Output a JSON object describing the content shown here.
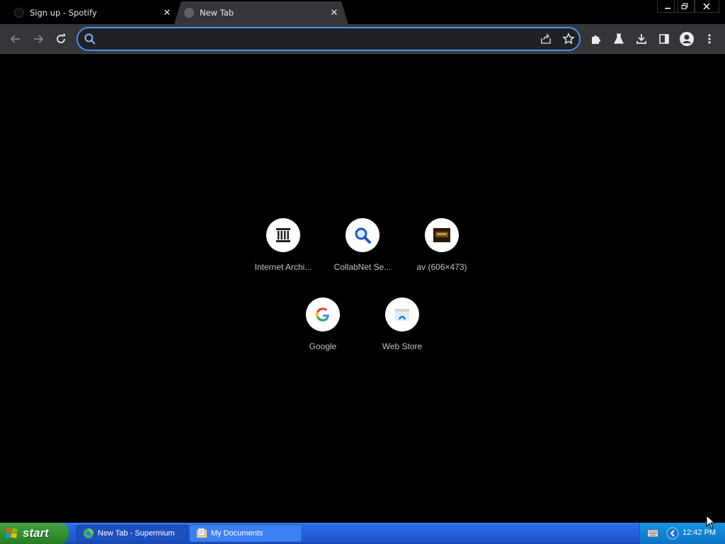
{
  "tabs": [
    {
      "title": "Sign up - Spotify",
      "active": false
    },
    {
      "title": "New Tab",
      "active": true
    }
  ],
  "window_controls": {
    "minimize": "–",
    "restore": "❐",
    "close": "✕"
  },
  "toolbar": {
    "back": "←",
    "forward": "→",
    "reload": "↻",
    "omnibox_value": "",
    "omnibox_placeholder": "",
    "menu": "⋮"
  },
  "shortcuts": [
    {
      "label": "Internet Archi...",
      "icon": "internet-archive-icon"
    },
    {
      "label": "CollabNet Se...",
      "icon": "magnifier-icon"
    },
    {
      "label": "av (606×473)",
      "icon": "av-thumbnail-icon"
    },
    {
      "label": "Google",
      "icon": "google-g-icon"
    },
    {
      "label": "Web Store",
      "icon": "web-store-icon"
    }
  ],
  "taskbar": {
    "start_label": "start",
    "tasks": [
      {
        "label": "New Tab - Supermium",
        "active": true
      },
      {
        "label": "My Documents",
        "active": false
      }
    ],
    "clock": "12:42 PM"
  },
  "colors": {
    "accent": "#4c8df6",
    "toolbar_bg": "#35363a",
    "page_bg": "#000000",
    "taskbar_blue": "#245edc",
    "start_green": "#3c9a3c"
  }
}
